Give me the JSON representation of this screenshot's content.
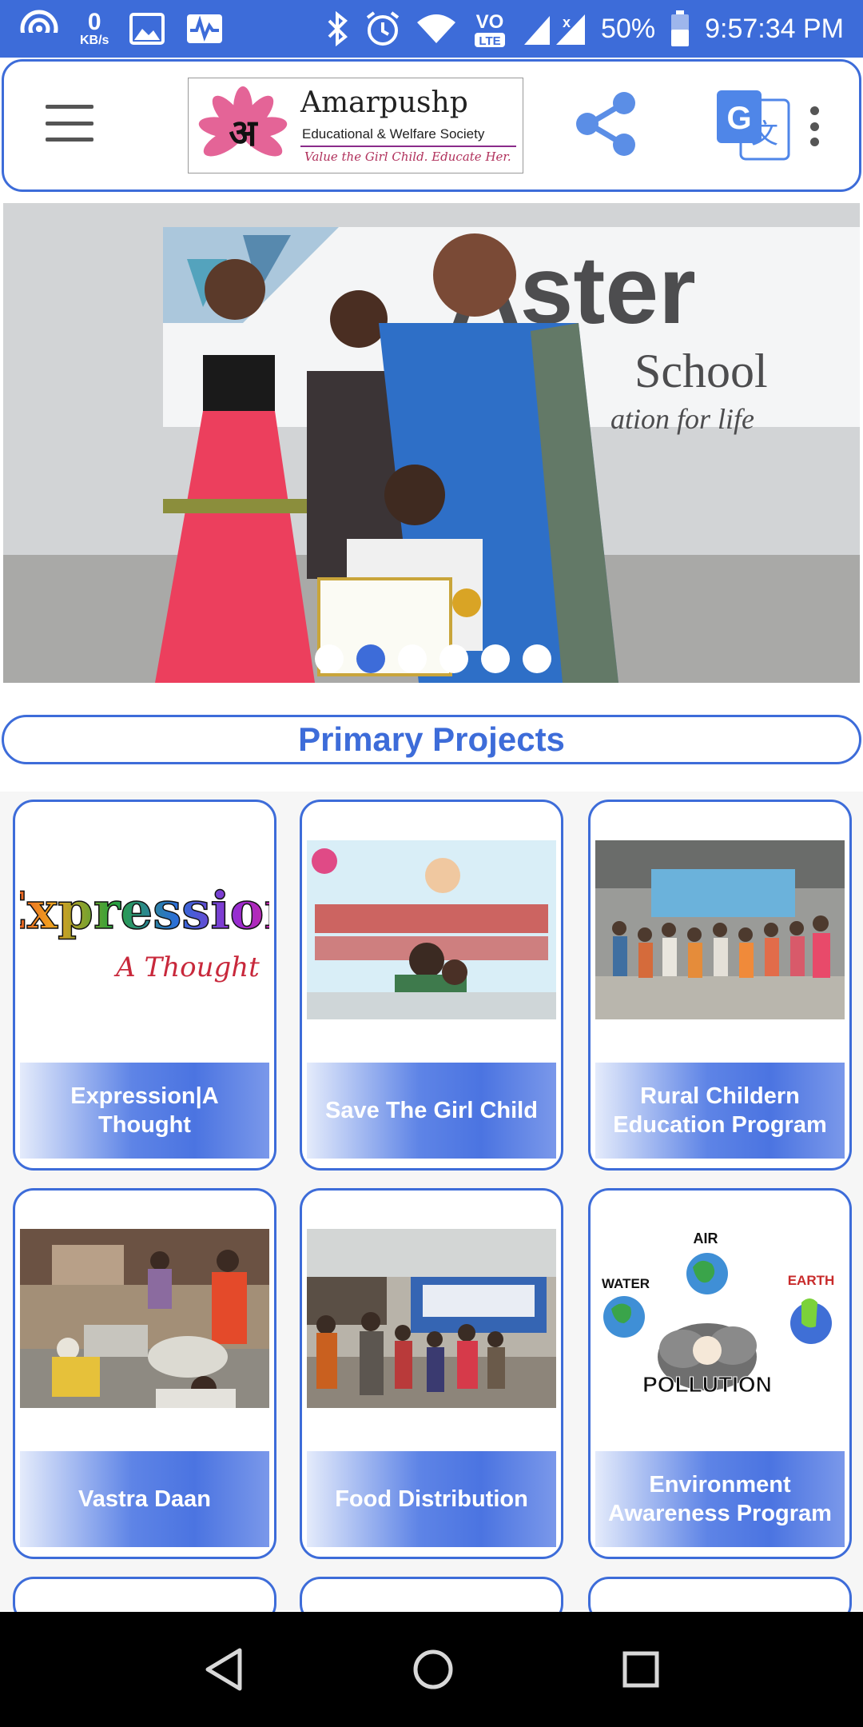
{
  "status_bar": {
    "net_speed_value": "0",
    "net_speed_unit": "KB/s",
    "battery": "50%",
    "time": "9:57:34 PM",
    "icons": [
      "hotspot-icon",
      "image-icon",
      "activity-icon",
      "bluetooth-icon",
      "alarm-icon",
      "wifi-icon",
      "volte-icon",
      "signal-icon",
      "battery-icon"
    ],
    "volte_label": "LTE"
  },
  "app_bar": {
    "logo_title": "Amarpushp",
    "logo_subtitle": "Educational & Welfare Society",
    "logo_tagline": "Value the Girl Child. Educate Her.",
    "logo_glyph": "अ"
  },
  "carousel": {
    "slide_count": 6,
    "active_index": 1
  },
  "section": {
    "title": "Primary Projects"
  },
  "projects": [
    {
      "label": "Expression|A Thought",
      "art": "expression"
    },
    {
      "label": "Save The Girl Child",
      "art": "banner"
    },
    {
      "label": "Rural Childern Education Program",
      "art": "group"
    },
    {
      "label": "Vastra Daan",
      "art": "market"
    },
    {
      "label": "Food Distribution",
      "art": "crowd"
    },
    {
      "label": "Environment Awareness Program",
      "art": "pollution"
    }
  ],
  "card_art": {
    "expression_word": "Expression",
    "expression_sub": "A Thought",
    "pollution_air": "AIR",
    "pollution_water": "WATER",
    "pollution_earth": "EARTH",
    "pollution_word": "POLLUTION"
  },
  "colors": {
    "accent": "#3d6cd9",
    "status_bar": "#3d6cd9",
    "nav_bar": "#000000"
  }
}
